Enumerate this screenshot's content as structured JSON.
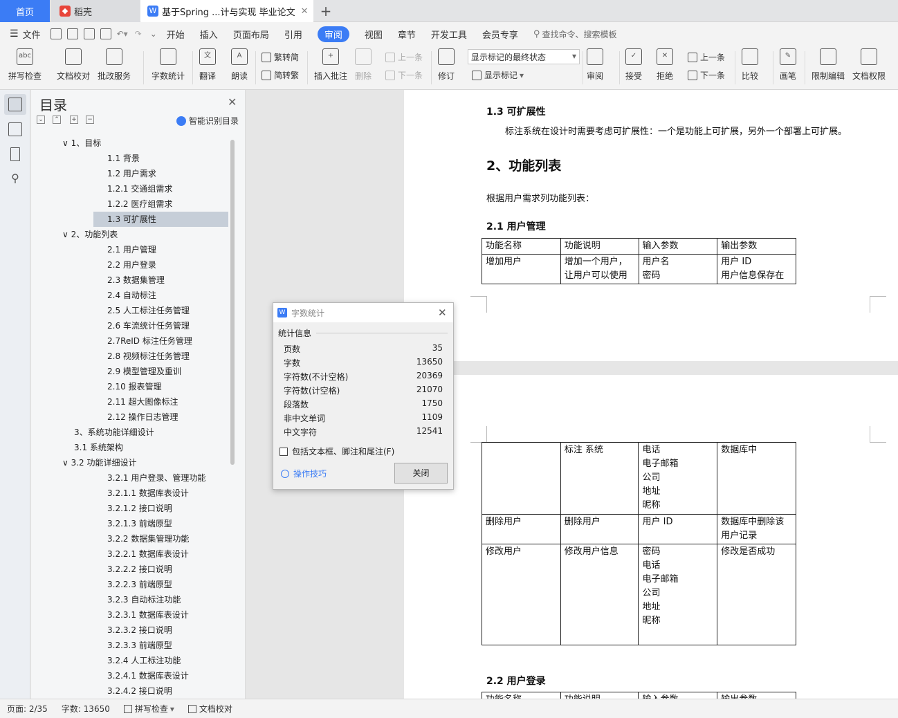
{
  "tabs": {
    "home": "首页",
    "daoke": "稻壳",
    "doc": "基于Spring ...计与实现 毕业论文"
  },
  "menu": {
    "file": "文件",
    "items": [
      "开始",
      "插入",
      "页面布局",
      "引用",
      "审阅",
      "视图",
      "章节",
      "开发工具",
      "会员专享"
    ],
    "active": "审阅",
    "search_placeholder": "查找命令、搜索模板"
  },
  "ribbon": {
    "spell": "拼写检查",
    "proof": "文档校对",
    "batch": "批改服务",
    "wordcount": "字数统计",
    "translate": "翻译",
    "read": "朗读",
    "to_simplified": "繁转简",
    "to_traditional": "简转繁",
    "insert_comment": "插入批注",
    "delete": "删除",
    "prev": "上一条",
    "next": "下一条",
    "revise": "修订",
    "mark_state": "显示标记的最终状态",
    "show_marks": "显示标记",
    "review": "审阅",
    "accept": "接受",
    "reject": "拒绝",
    "prev2": "上一条",
    "next2": "下一条",
    "compare": "比较",
    "pen": "画笔",
    "restrict": "限制编辑",
    "doc_rights": "文档权限"
  },
  "toc": {
    "title": "目录",
    "smart": "智能识别目录",
    "items": [
      {
        "t": "∨  1、目标",
        "lv": 0
      },
      {
        "t": "1.1  背景",
        "lv": 1
      },
      {
        "t": "1.2  用户需求",
        "lv": 1
      },
      {
        "t": "1.2.1  交通组需求",
        "lv": 1
      },
      {
        "t": "1.2.2  医疗组需求",
        "lv": 1
      },
      {
        "t": "1.3  可扩展性",
        "lv": 1,
        "sel": true
      },
      {
        "t": "∨  2、功能列表",
        "lv": 0
      },
      {
        "t": "2.1 用户管理",
        "lv": 1
      },
      {
        "t": "2.2 用户登录",
        "lv": 1
      },
      {
        "t": "2.3 数据集管理",
        "lv": 1
      },
      {
        "t": "2.4 自动标注",
        "lv": 1
      },
      {
        "t": "2.5 人工标注任务管理",
        "lv": 1
      },
      {
        "t": "2.6 车流统计任务管理",
        "lv": 1
      },
      {
        "t": "2.7ReID 标注任务管理",
        "lv": 1
      },
      {
        "t": "2.8 视频标注任务管理",
        "lv": 1
      },
      {
        "t": "2.9 模型管理及重训",
        "lv": 1
      },
      {
        "t": "2.10 报表管理",
        "lv": 1
      },
      {
        "t": "2.11 超大图像标注",
        "lv": 1
      },
      {
        "t": "2.12 操作日志管理",
        "lv": 1
      },
      {
        "t": "3、系统功能详细设计",
        "lv": 2
      },
      {
        "t": "3.1 系统架构",
        "lv": 2
      },
      {
        "t": "∨  3.2 功能详细设计",
        "lv": 0
      },
      {
        "t": "3.2.1  用户登录、管理功能",
        "lv": 1
      },
      {
        "t": "3.2.1.1  数据库表设计",
        "lv": 1
      },
      {
        "t": "3.2.1.2  接口说明",
        "lv": 1
      },
      {
        "t": "3.2.1.3  前端原型",
        "lv": 1
      },
      {
        "t": "3.2.2  数据集管理功能",
        "lv": 1
      },
      {
        "t": "3.2.2.1  数据库表设计",
        "lv": 1
      },
      {
        "t": "3.2.2.2  接口说明",
        "lv": 1
      },
      {
        "t": "3.2.2.3  前端原型",
        "lv": 1
      },
      {
        "t": "3.2.3  自动标注功能",
        "lv": 1
      },
      {
        "t": "3.2.3.1  数据库表设计",
        "lv": 1
      },
      {
        "t": "3.2.3.2  接口说明",
        "lv": 1
      },
      {
        "t": "3.2.3.3  前端原型",
        "lv": 1
      },
      {
        "t": "3.2.4  人工标注功能",
        "lv": 1
      },
      {
        "t": "3.2.4.1  数据库表设计",
        "lv": 1
      },
      {
        "t": "3.2.4.2  接口说明",
        "lv": 1
      }
    ]
  },
  "doc": {
    "h13": "1.3  可扩展性",
    "p13": "标注系统在设计时需要考虑可扩展性：一个是功能上可扩展，另外一个部署上可扩展。",
    "h2": "2、功能列表",
    "p2": "根据用户需求列功能列表：",
    "h21": "2.1 用户管理",
    "table1": {
      "head": [
        "功能名称",
        "功能说明",
        "输入参数",
        "输出参数"
      ],
      "row": [
        "增加用户",
        "增加一个用户，\n让用户可以使用",
        "用户名\n密码",
        "用户 ID\n用户信息保存在"
      ]
    },
    "table2": [
      [
        "",
        "标注  系统",
        "电话\n电子邮箱\n公司\n地址\n昵称",
        "数据库中"
      ],
      [
        "删除用户",
        "删除用户",
        "用户 ID",
        "数据库中删除该\n用户记录"
      ],
      [
        "修改用户",
        "修改用户信息",
        "密码\n电话\n电子邮箱\n公司\n地址\n昵称",
        "修改是否成功"
      ]
    ],
    "h22": "2.2 用户登录",
    "table3_head": [
      "功能名称",
      "功能说明",
      "输入参数",
      "输出参数"
    ]
  },
  "dialog": {
    "title": "字数统计",
    "section": "统计信息",
    "stats": [
      {
        "k": "页数",
        "v": "35"
      },
      {
        "k": "字数",
        "v": "13650"
      },
      {
        "k": "字符数(不计空格)",
        "v": "20369"
      },
      {
        "k": "字符数(计空格)",
        "v": "21070"
      },
      {
        "k": "段落数",
        "v": "1750"
      },
      {
        "k": "非中文单词",
        "v": "1109"
      },
      {
        "k": "中文字符",
        "v": "12541"
      }
    ],
    "checkbox": "包括文本框、脚注和尾注(F)",
    "tips": "操作技巧",
    "close": "关闭"
  },
  "status": {
    "page": "页面: 2/35",
    "words": "字数: 13650",
    "spell": "拼写检查",
    "proof": "文档校对"
  },
  "colors": {
    "accent": "#3b7cf5",
    "daoke_red": "#e8443a"
  }
}
